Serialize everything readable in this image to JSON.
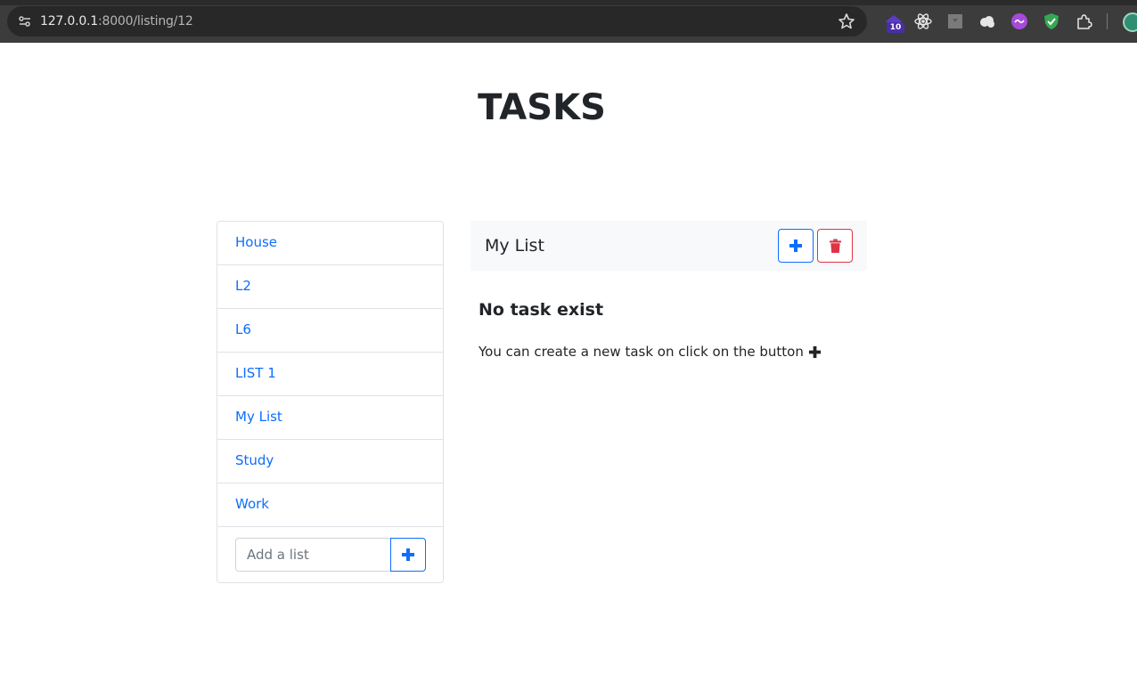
{
  "browser": {
    "url_host": "127.0.0.1",
    "url_path": ":8000/listing/12",
    "extension_badge": "10"
  },
  "page": {
    "title": "TASKS"
  },
  "sidebar": {
    "items": [
      {
        "label": "House"
      },
      {
        "label": "L2"
      },
      {
        "label": "L6"
      },
      {
        "label": "LIST 1"
      },
      {
        "label": "My List"
      },
      {
        "label": "Study"
      },
      {
        "label": "Work"
      }
    ],
    "add_placeholder": "Add a list"
  },
  "main": {
    "list_title": "My List",
    "empty_title": "No task exist",
    "empty_text": "You can create a new task on click on the button"
  },
  "colors": {
    "primary": "#0d6efd",
    "danger": "#dc3545",
    "text": "#212529",
    "border": "#dee2e6",
    "header_bg": "#f8f9fa"
  }
}
